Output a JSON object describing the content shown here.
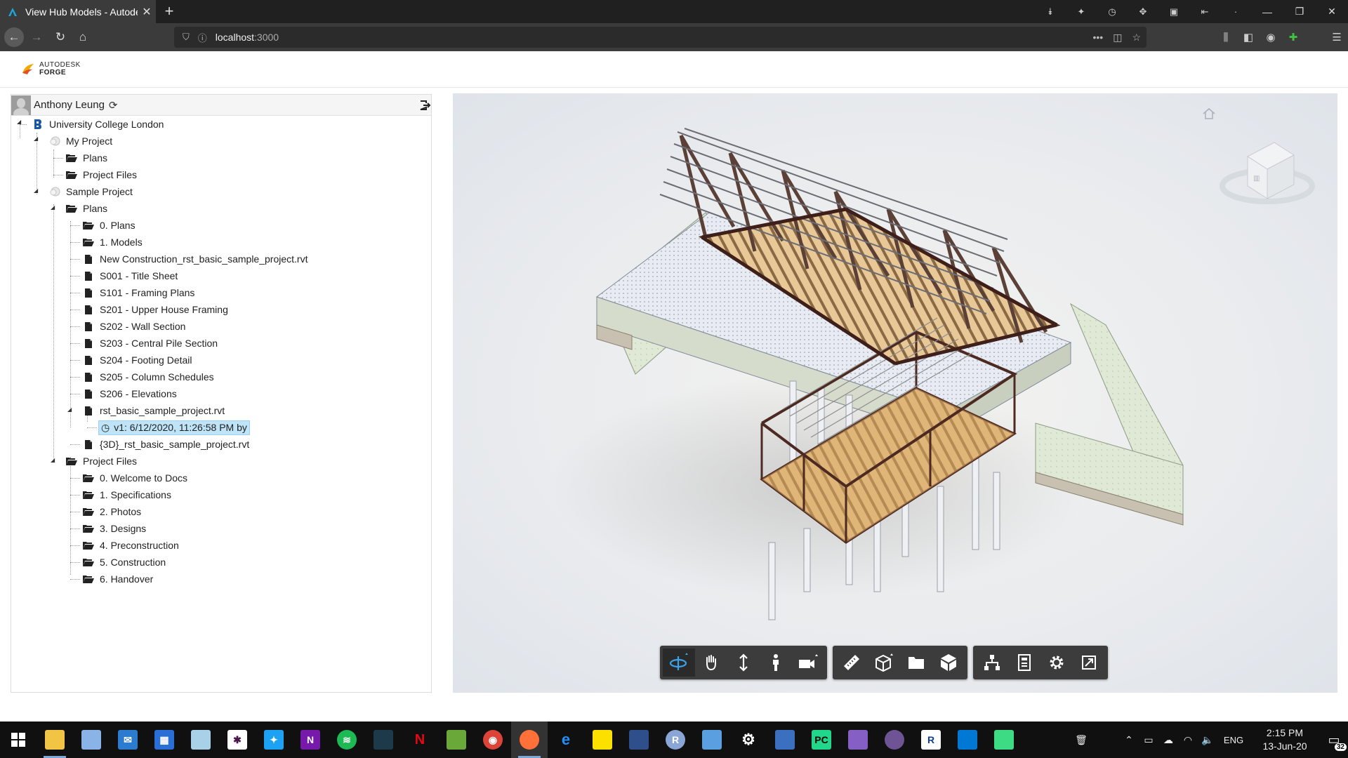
{
  "browser": {
    "tab_title": "View Hub Models - Autodesk F",
    "url_host": "localhost",
    "url_port": ":3000"
  },
  "app": {
    "logo_line1": "AUTODESK",
    "logo_line2": "FORGE"
  },
  "user": {
    "name": "Anthony Leung"
  },
  "tree": {
    "hub": "University College London",
    "my_project": "My Project",
    "my_plans": "Plans",
    "my_project_files": "Project Files",
    "sample_project": "Sample Project",
    "sample_plans": "Plans",
    "plans_items": [
      "0. Plans",
      "1. Models",
      "New Construction_rst_basic_sample_project.rvt",
      "S001 - Title Sheet",
      "S101 - Framing Plans",
      "S201 - Upper House Framing",
      "S202 - Wall Section",
      "S203 - Central Pile Section",
      "S204 - Footing Detail",
      "S205 - Column Schedules",
      "S206 - Elevations",
      "rst_basic_sample_project.rvt"
    ],
    "version_item": "v1: 6/12/2020, 11:26:58 PM by",
    "item_3d": "{3D}_rst_basic_sample_project.rvt",
    "sample_project_files": "Project Files",
    "files_items": [
      "0. Welcome to Docs",
      "1. Specifications",
      "2. Photos",
      "3. Designs",
      "4. Preconstruction",
      "5. Construction",
      "6. Handover"
    ]
  },
  "taskbar": {
    "language": "ENG",
    "time": "2:15 PM",
    "date": "13-Jun-20",
    "notification_count": "32"
  },
  "colors": {
    "accent": "#0696d7",
    "selection": "#bfe3f7",
    "toolbar_bg": "#3c3c3c",
    "toolbar_active_icon": "#3ba3e8"
  }
}
